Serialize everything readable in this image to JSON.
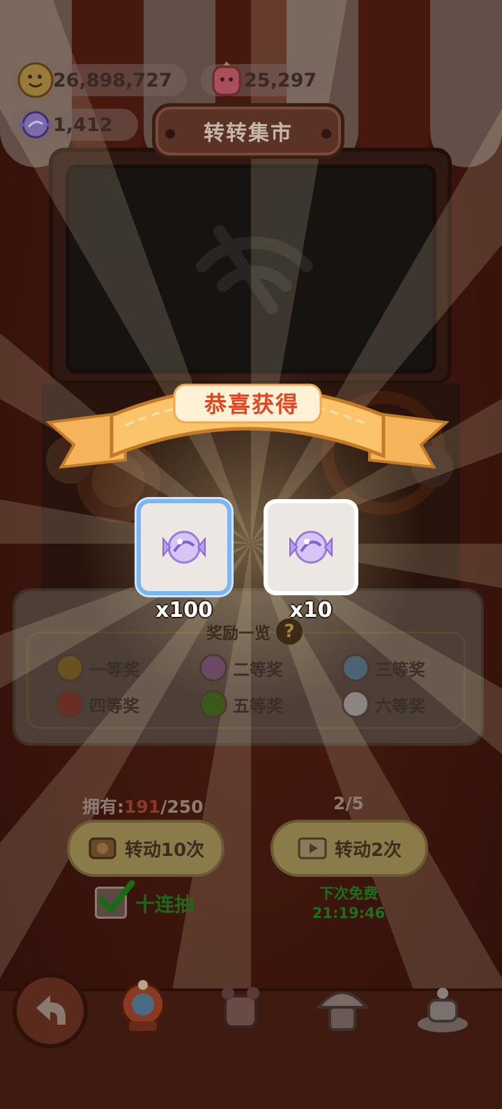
{
  "currency": {
    "coins": "26,898,727",
    "gems": "25,297",
    "candy": "1,412"
  },
  "title": "转转集市",
  "popup": {
    "banner": "恭喜获得",
    "rewards": [
      {
        "icon": "crystal-candy-icon",
        "quantity": "x100"
      },
      {
        "icon": "crystal-candy-icon",
        "quantity": "x10"
      }
    ]
  },
  "prize_panel": {
    "title": "奖励一览",
    "help": "?",
    "prizes": [
      {
        "label": "一等奖",
        "color": "#b8901c"
      },
      {
        "label": "二等奖",
        "color": "#a883a8"
      },
      {
        "label": "三等奖",
        "color": "#7fa3bd"
      },
      {
        "label": "四等奖",
        "color": "#a84a36"
      },
      {
        "label": "五等奖",
        "color": "#5e8a2c"
      },
      {
        "label": "六等奖",
        "color": "#cfcac6"
      }
    ]
  },
  "spin": {
    "owned_label": "拥有:",
    "owned_current": "191",
    "owned_max": "/250",
    "spin10_label": "转动10次",
    "counter": "2/5",
    "spin2_label": "转动2次",
    "ten_pull_label": "十连抽",
    "ten_pull_checked": true,
    "free_label": "下次免费",
    "free_timer": "21:19:46"
  },
  "nav": {
    "items": [
      "back-arrow-icon",
      "lottery-machine-icon",
      "bear-costume-icon",
      "mushroom-house-icon",
      "tea-set-icon"
    ]
  }
}
